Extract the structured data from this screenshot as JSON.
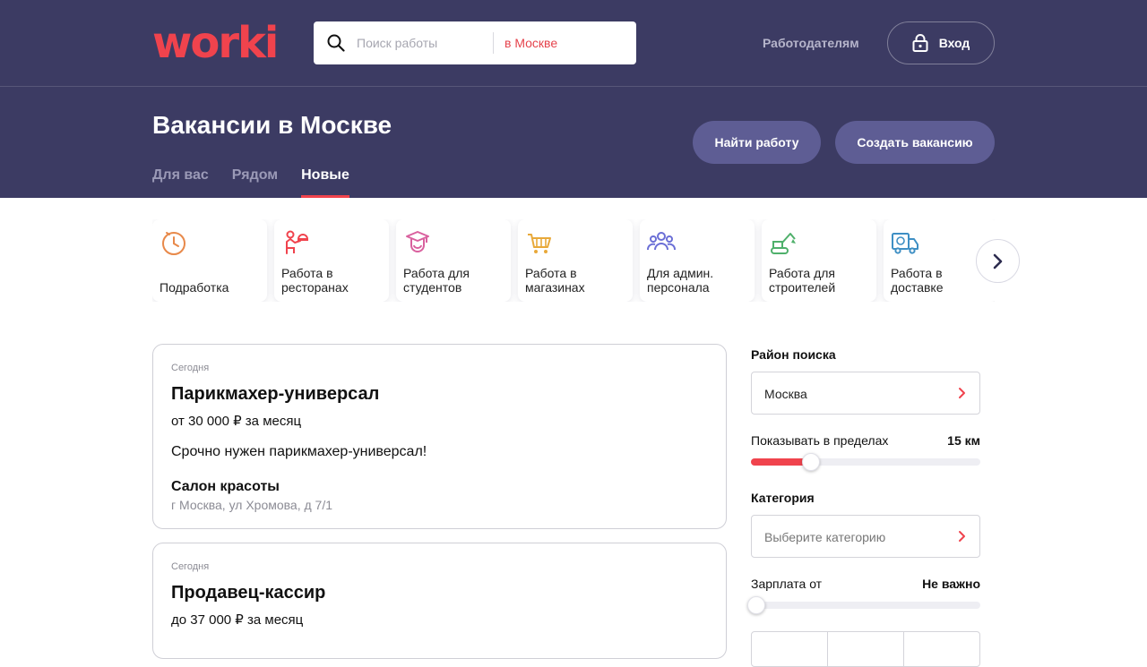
{
  "brand": {
    "logo_text": "worki",
    "accent_color": "#f0434d",
    "header_bg": "#3c3b63"
  },
  "search": {
    "placeholder": "Поиск работы",
    "value": "",
    "city": "в Москве"
  },
  "header": {
    "employers_link": "Работодателям",
    "login_label": "Вход"
  },
  "page": {
    "title": "Вакансии в Москве",
    "tabs": [
      {
        "label": "Для вас",
        "active": false
      },
      {
        "label": "Рядом",
        "active": false
      },
      {
        "label": "Новые",
        "active": true
      }
    ],
    "find_job_button": "Найти работу",
    "create_vacancy_button": "Создать вакансию"
  },
  "categories": [
    {
      "label": "Подработка",
      "icon": "clock-icon",
      "color": "#e8894a"
    },
    {
      "label": "Работа в\nресторанах",
      "icon": "waiter-icon",
      "color": "#f0434d"
    },
    {
      "label": "Работа для\nстудентов",
      "icon": "student-icon",
      "color": "#d9609e"
    },
    {
      "label": "Работа в\nмагазинах",
      "icon": "shopping-cart-icon",
      "color": "#e8a93a"
    },
    {
      "label": "Для админ.\nперсонала",
      "icon": "team-icon",
      "color": "#6b6fd6"
    },
    {
      "label": "Работа для\nстроителей",
      "icon": "excavator-icon",
      "color": "#4fb06b"
    },
    {
      "label": "Работа в\nдоставке",
      "icon": "delivery-truck-icon",
      "color": "#3e8fc4"
    }
  ],
  "vacancies": [
    {
      "date": "Сегодня",
      "title": "Парикмахер-универсал",
      "salary": "от 30 000 ₽ за месяц",
      "description": "Срочно нужен парикмахер-универсал!",
      "company": "Салон красоты",
      "address": "г Москва, ул Хромова, д 7/1"
    },
    {
      "date": "Сегодня",
      "title": "Продавец-кассир",
      "salary": "до 37 000 ₽ за месяц"
    }
  ],
  "filters": {
    "region_label": "Район поиска",
    "region_value": "Москва",
    "radius_label": "Показывать в пределах",
    "radius_value": "15 км",
    "radius_fraction": 0.26,
    "category_label": "Категория",
    "category_placeholder": "Выберите категорию",
    "salary_label": "Зарплата от",
    "salary_value": "Не важно",
    "salary_fraction": 0
  }
}
